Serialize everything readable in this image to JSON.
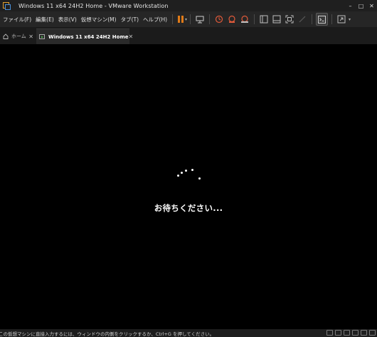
{
  "window": {
    "title": "Windows 11 x64 24H2 Home - VMware Workstation",
    "controls": {
      "minimize": "–",
      "maximize": "□",
      "close": "✕"
    }
  },
  "menu": {
    "items": [
      {
        "label": "ファイル(F)"
      },
      {
        "label": "編集(E)"
      },
      {
        "label": "表示(V)"
      },
      {
        "label": "仮想マシン(M)"
      },
      {
        "label": "タブ(T)"
      },
      {
        "label": "ヘルプ(H)"
      }
    ]
  },
  "toolbar": {
    "icons": [
      "pause-icon",
      "send-keys-icon",
      "snapshot-icon",
      "revert-snapshot-icon",
      "snapshot-manager-icon",
      "library-icon",
      "thumbnail-icon",
      "fullscreen-icon",
      "unity-icon",
      "console-icon",
      "stretch-icon"
    ],
    "accent_pause": "#e07b18"
  },
  "tabs": [
    {
      "label": "ホーム",
      "close": "✕"
    },
    {
      "label": "Windows 11 x64 24H2 Home",
      "close": "✕"
    }
  ],
  "vm_screen": {
    "message": "お待ちください...",
    "background": "#000000"
  },
  "status": {
    "text": "この仮想マシンに直接入力するには、ウィンドウの内側をクリックするか、Ctrl+G を押してください。"
  }
}
